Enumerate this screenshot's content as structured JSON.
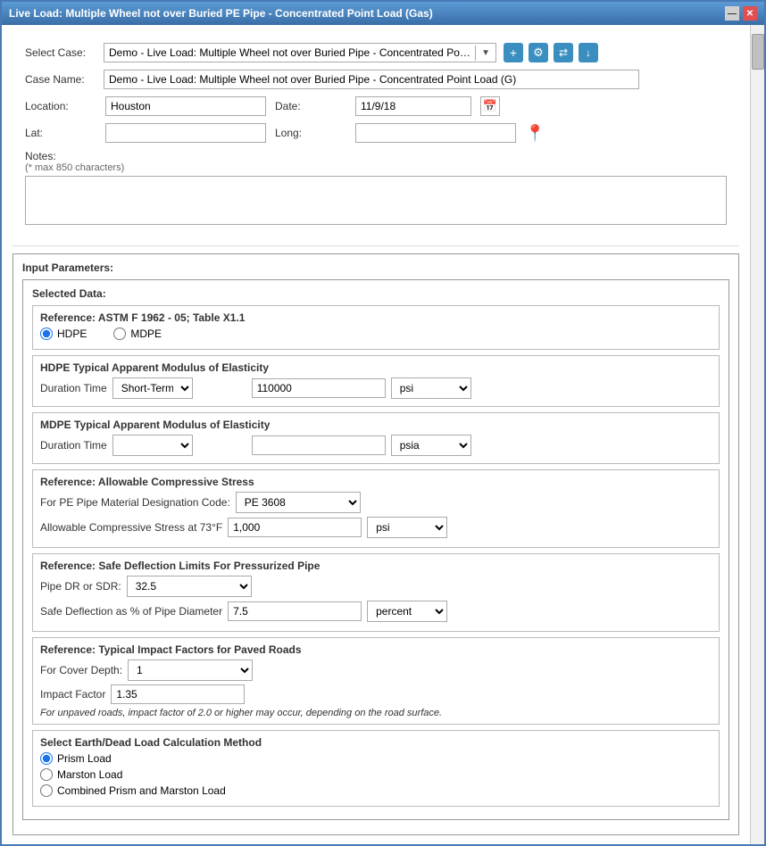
{
  "window": {
    "title": "Live Load: Multiple Wheel not over Buried PE Pipe - Concentrated Point Load (Gas)"
  },
  "header": {
    "select_case_label": "Select Case:",
    "select_case_value": "Demo - Live Load: Multiple Wheel not over Buried Pipe - Concentrated Point L...",
    "case_name_label": "Case Name:",
    "case_name_value": "Demo - Live Load: Multiple Wheel not over Buried Pipe - Concentrated Point Load (G)",
    "location_label": "Location:",
    "location_value": "Houston",
    "date_label": "Date:",
    "date_value": "11/9/18",
    "lat_label": "Lat:",
    "lat_value": "",
    "long_label": "Long:",
    "long_value": "",
    "notes_label": "Notes:",
    "notes_sublabel": "(* max 850 characters)",
    "notes_value": ""
  },
  "input_params": {
    "section_title": "Input Parameters:",
    "selected_data_title": "Selected Data:",
    "reference1_title": "Reference: ASTM F 1962 - 05; Table X1.1",
    "hdpe_label": "HDPE",
    "mdpe_label": "MDPE",
    "hdpe_modulus_title": "HDPE Typical Apparent Modulus of Elasticity",
    "duration_time_label": "Duration Time",
    "hdpe_duration_value": "Short-Term",
    "hdpe_modulus_value": "110000",
    "hdpe_unit": "psi",
    "mdpe_modulus_title": "MDPE Typical Apparent Modulus of Elasticity",
    "mdpe_duration_value": "",
    "mdpe_modulus_value": "",
    "mdpe_unit": "psia",
    "compressive_stress_title": "Reference: Allowable Compressive Stress",
    "pe_material_label": "For PE Pipe Material Designation Code:",
    "pe_material_value": "PE 3608",
    "compressive_stress_label": "Allowable Compressive Stress at 73°F",
    "compressive_stress_value": "1,000",
    "compressive_stress_unit": "psi",
    "deflection_title": "Reference: Safe Deflection Limits For Pressurized Pipe",
    "pipe_dr_label": "Pipe DR or SDR:",
    "pipe_dr_value": "32.5",
    "safe_deflection_label": "Safe Deflection as % of Pipe Diameter",
    "safe_deflection_value": "7.5",
    "safe_deflection_unit": "percent",
    "impact_title": "Reference: Typical Impact Factors for Paved Roads",
    "cover_depth_label": "For Cover Depth:",
    "cover_depth_value": "1",
    "impact_factor_label": "Impact Factor",
    "impact_factor_value": "1.35",
    "impact_note": "For unpaved roads, impact factor of 2.0 or higher may occur, depending on the road surface.",
    "earth_load_title": "Select Earth/Dead Load Calculation Method",
    "prism_load_label": "Prism Load",
    "marston_load_label": "Marston Load",
    "combined_load_label": "Combined Prism and Marston Load"
  },
  "icons": {
    "add": "+",
    "settings": "⚙",
    "share": "⇄",
    "download": "↓",
    "calendar": "📅",
    "map_pin": "📍",
    "dropdown_arrow": "▼"
  }
}
